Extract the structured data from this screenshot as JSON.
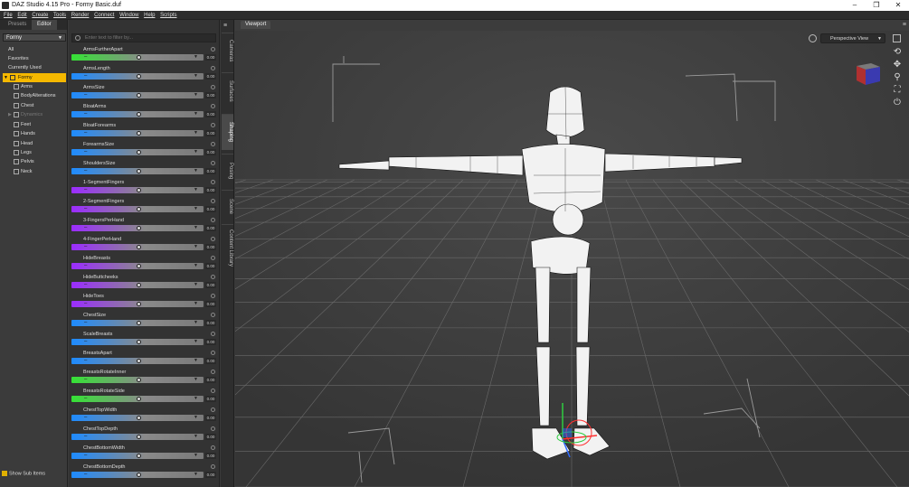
{
  "window": {
    "title": "DAZ Studio 4.15 Pro - Formy Basic.duf"
  },
  "menu": [
    "File",
    "Edit",
    "Create",
    "Tools",
    "Render",
    "Connect",
    "Window",
    "Help",
    "Scripts"
  ],
  "left_panel": {
    "tabs": {
      "presets": "Presets",
      "editor": "Editor"
    },
    "figure_select": "Formy",
    "categories": [
      {
        "label": "All"
      },
      {
        "label": "Favorites"
      },
      {
        "label": "Currently Used"
      },
      {
        "label": "Formy"
      },
      {
        "label": "Arms"
      },
      {
        "label": "BodyAlterations"
      },
      {
        "label": "Chest"
      },
      {
        "label": "Dynamics"
      },
      {
        "label": "Feet"
      },
      {
        "label": "Hands"
      },
      {
        "label": "Head"
      },
      {
        "label": "Legs"
      },
      {
        "label": "Pelvis"
      },
      {
        "label": "Neck"
      }
    ],
    "show_sub_items": "Show Sub Items"
  },
  "slider_panel": {
    "filter_placeholder": "Enter text to filter by...",
    "sliders": [
      {
        "label": "ArmsFurtherApart",
        "color": "#35e335",
        "value": "0.00"
      },
      {
        "label": "ArmsLength",
        "color": "#1e8bff",
        "value": "0.00"
      },
      {
        "label": "ArmsSize",
        "color": "#1e8bff",
        "value": "0.00"
      },
      {
        "label": "BloatArms",
        "color": "#1e8bff",
        "value": "0.00"
      },
      {
        "label": "BloatForearms",
        "color": "#1e8bff",
        "value": "0.00"
      },
      {
        "label": "ForearmsSize",
        "color": "#1e8bff",
        "value": "0.00"
      },
      {
        "label": "ShouldersSize",
        "color": "#1e8bff",
        "value": "0.00"
      },
      {
        "label": "1-SegmentFingers",
        "color": "#9b2cff",
        "value": "0.00"
      },
      {
        "label": "2-SegmentFingers",
        "color": "#9b2cff",
        "value": "0.00"
      },
      {
        "label": "3-FingersPerHand",
        "color": "#9b2cff",
        "value": "0.00"
      },
      {
        "label": "4-FingerPerHand",
        "color": "#9b2cff",
        "value": "0.00"
      },
      {
        "label": "HideBreasts",
        "color": "#9b2cff",
        "value": "0.00"
      },
      {
        "label": "HideButtcheeks",
        "color": "#9b2cff",
        "value": "0.00"
      },
      {
        "label": "HideToes",
        "color": "#9b2cff",
        "value": "0.00"
      },
      {
        "label": "ChestSize",
        "color": "#1e8bff",
        "value": "0.00"
      },
      {
        "label": "ScaleBreasts",
        "color": "#1e8bff",
        "value": "0.00"
      },
      {
        "label": "BreastsApart",
        "color": "#1e8bff",
        "value": "0.00"
      },
      {
        "label": "BreastsRotateInner",
        "color": "#35e335",
        "value": "0.00"
      },
      {
        "label": "BreastsRotateSide",
        "color": "#35e335",
        "value": "0.00"
      },
      {
        "label": "ChestTopWidth",
        "color": "#1e8bff",
        "value": "0.00"
      },
      {
        "label": "ChestTopDepth",
        "color": "#1e8bff",
        "value": "0.00"
      },
      {
        "label": "ChestBottomWidth",
        "color": "#1e8bff",
        "value": "0.00"
      },
      {
        "label": "ChestBottomDepth",
        "color": "#1e8bff",
        "value": "0.00"
      }
    ]
  },
  "side_tabs": [
    "Cameras",
    "Surfaces",
    "Shaping",
    "Posing",
    "Scene",
    "Content Library"
  ],
  "viewport": {
    "tab": "Viewport",
    "view_select": "Perspective View"
  }
}
